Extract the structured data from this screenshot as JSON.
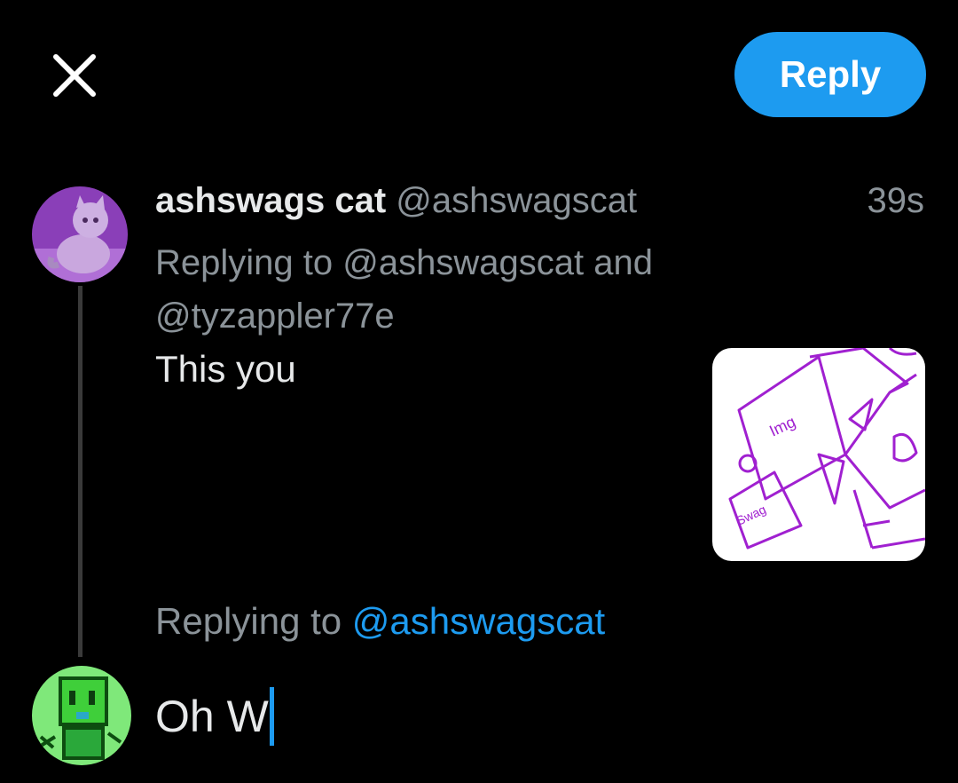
{
  "header": {
    "close_icon": "close-icon",
    "reply_label": "Reply"
  },
  "tweet": {
    "display_name": "ashswags cat",
    "handle": "@ashswagscat",
    "timestamp": "39s",
    "replying_prefix": "Replying to",
    "replying_handle_1": "@ashswagscat",
    "replying_and": "and",
    "replying_handle_2": "@tyzappler77e",
    "text": "This you",
    "media_labels": [
      "Img",
      "Swag"
    ]
  },
  "composer": {
    "replying_prefix": "Replying to",
    "replying_handle": "@ashswagscat",
    "draft_text": "Oh W"
  },
  "colors": {
    "accent": "#1d9bf0",
    "background": "#000000",
    "muted_text": "#8b9399",
    "primary_text": "#e7e9ea",
    "drawing_purple": "#a020d0"
  }
}
